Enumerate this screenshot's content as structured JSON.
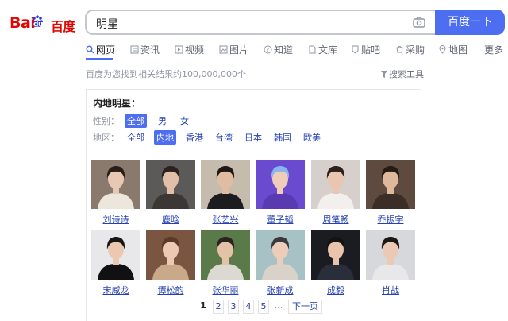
{
  "header": {
    "logo_text_bai": "Bai",
    "logo_text_du": "du",
    "logo_text_cn": "百度",
    "search_value": "明星",
    "search_button": "百度一下"
  },
  "tabs": [
    {
      "label": "网页",
      "icon": "search-icon",
      "active": true
    },
    {
      "label": "资讯",
      "icon": "news-icon",
      "active": false
    },
    {
      "label": "视频",
      "icon": "video-icon",
      "active": false
    },
    {
      "label": "图片",
      "icon": "image-icon",
      "active": false
    },
    {
      "label": "知道",
      "icon": "question-icon",
      "active": false
    },
    {
      "label": "文库",
      "icon": "doc-icon",
      "active": false
    },
    {
      "label": "贴吧",
      "icon": "tieba-icon",
      "active": false
    },
    {
      "label": "采购",
      "icon": "purchase-icon",
      "active": false
    },
    {
      "label": "地图",
      "icon": "map-icon",
      "active": false
    },
    {
      "label": "更多",
      "icon": "",
      "active": false
    }
  ],
  "result_info": "百度为您找到相关结果约100,000,000个",
  "search_tools": "搜索工具",
  "card": {
    "title": "内地明星：",
    "gender_label": "性别：",
    "gender_options": [
      {
        "label": "全部",
        "selected": true
      },
      {
        "label": "男",
        "selected": false
      },
      {
        "label": "女",
        "selected": false
      }
    ],
    "region_label": "地区：",
    "region_options": [
      {
        "label": "全部",
        "selected": false
      },
      {
        "label": "内地",
        "selected": true
      },
      {
        "label": "香港",
        "selected": false
      },
      {
        "label": "台湾",
        "selected": false
      },
      {
        "label": "日本",
        "selected": false
      },
      {
        "label": "韩国",
        "selected": false
      },
      {
        "label": "欧美",
        "selected": false
      }
    ],
    "people": [
      {
        "name": "刘诗诗",
        "bg": "#8a7a6e",
        "face": "#e8c8b4",
        "hair": "#2a1d18",
        "cloth": "#ece6dd"
      },
      {
        "name": "鹿晗",
        "bg": "#5c5a58",
        "face": "#e2c0a8",
        "hair": "#2b2220",
        "cloth": "#3a3734"
      },
      {
        "name": "张艺兴",
        "bg": "#c5bcae",
        "face": "#e0bda0",
        "hair": "#1f1815",
        "cloth": "#1d1d1f"
      },
      {
        "name": "董子韬",
        "bg": "#6a4bd0",
        "face": "#f0cdb8",
        "hair": "#8ab4f0",
        "cloth": "#5a3ab0"
      },
      {
        "name": "周笔畅",
        "bg": "#d6cfcc",
        "face": "#e8c6b2",
        "hair": "#2d211d",
        "cloth": "#f2efec"
      },
      {
        "name": "乔振宇",
        "bg": "#5e4a3e",
        "face": "#dfb89c",
        "hair": "#251a14",
        "cloth": "#3b2e26"
      },
      {
        "name": "宋威龙",
        "bg": "#e8e8ea",
        "face": "#ecc8b0",
        "hair": "#1a1615",
        "cloth": "#111113"
      },
      {
        "name": "谭松韵",
        "bg": "#7a5640",
        "face": "#edc9b3",
        "hair": "#5a3a28",
        "cloth": "#c9a98a"
      },
      {
        "name": "张华丽",
        "bg": "#5a7a4a",
        "face": "#e4c2a8",
        "hair": "#2a2420",
        "cloth": "#dcd9d2"
      },
      {
        "name": "张新成",
        "bg": "#a7c2c4",
        "face": "#eecdb8",
        "hair": "#3a3a3c",
        "cloth": "#d8d2c8"
      },
      {
        "name": "成毅",
        "bg": "#1a1c22",
        "face": "#e8c4ac",
        "hair": "#141212",
        "cloth": "#2a2e3a"
      },
      {
        "name": "肖战",
        "bg": "#d7d8dc",
        "face": "#ecc9b2",
        "hair": "#1c1816",
        "cloth": "#e8e8ea"
      }
    ],
    "pager": {
      "pages": [
        "1",
        "2",
        "3",
        "4",
        "5"
      ],
      "current": "1",
      "ellipsis": "...",
      "next": "下一页"
    }
  },
  "colors": {
    "brand_red": "#e10601",
    "brand_blue": "#4e6ef2",
    "link_blue": "#2440b3"
  }
}
